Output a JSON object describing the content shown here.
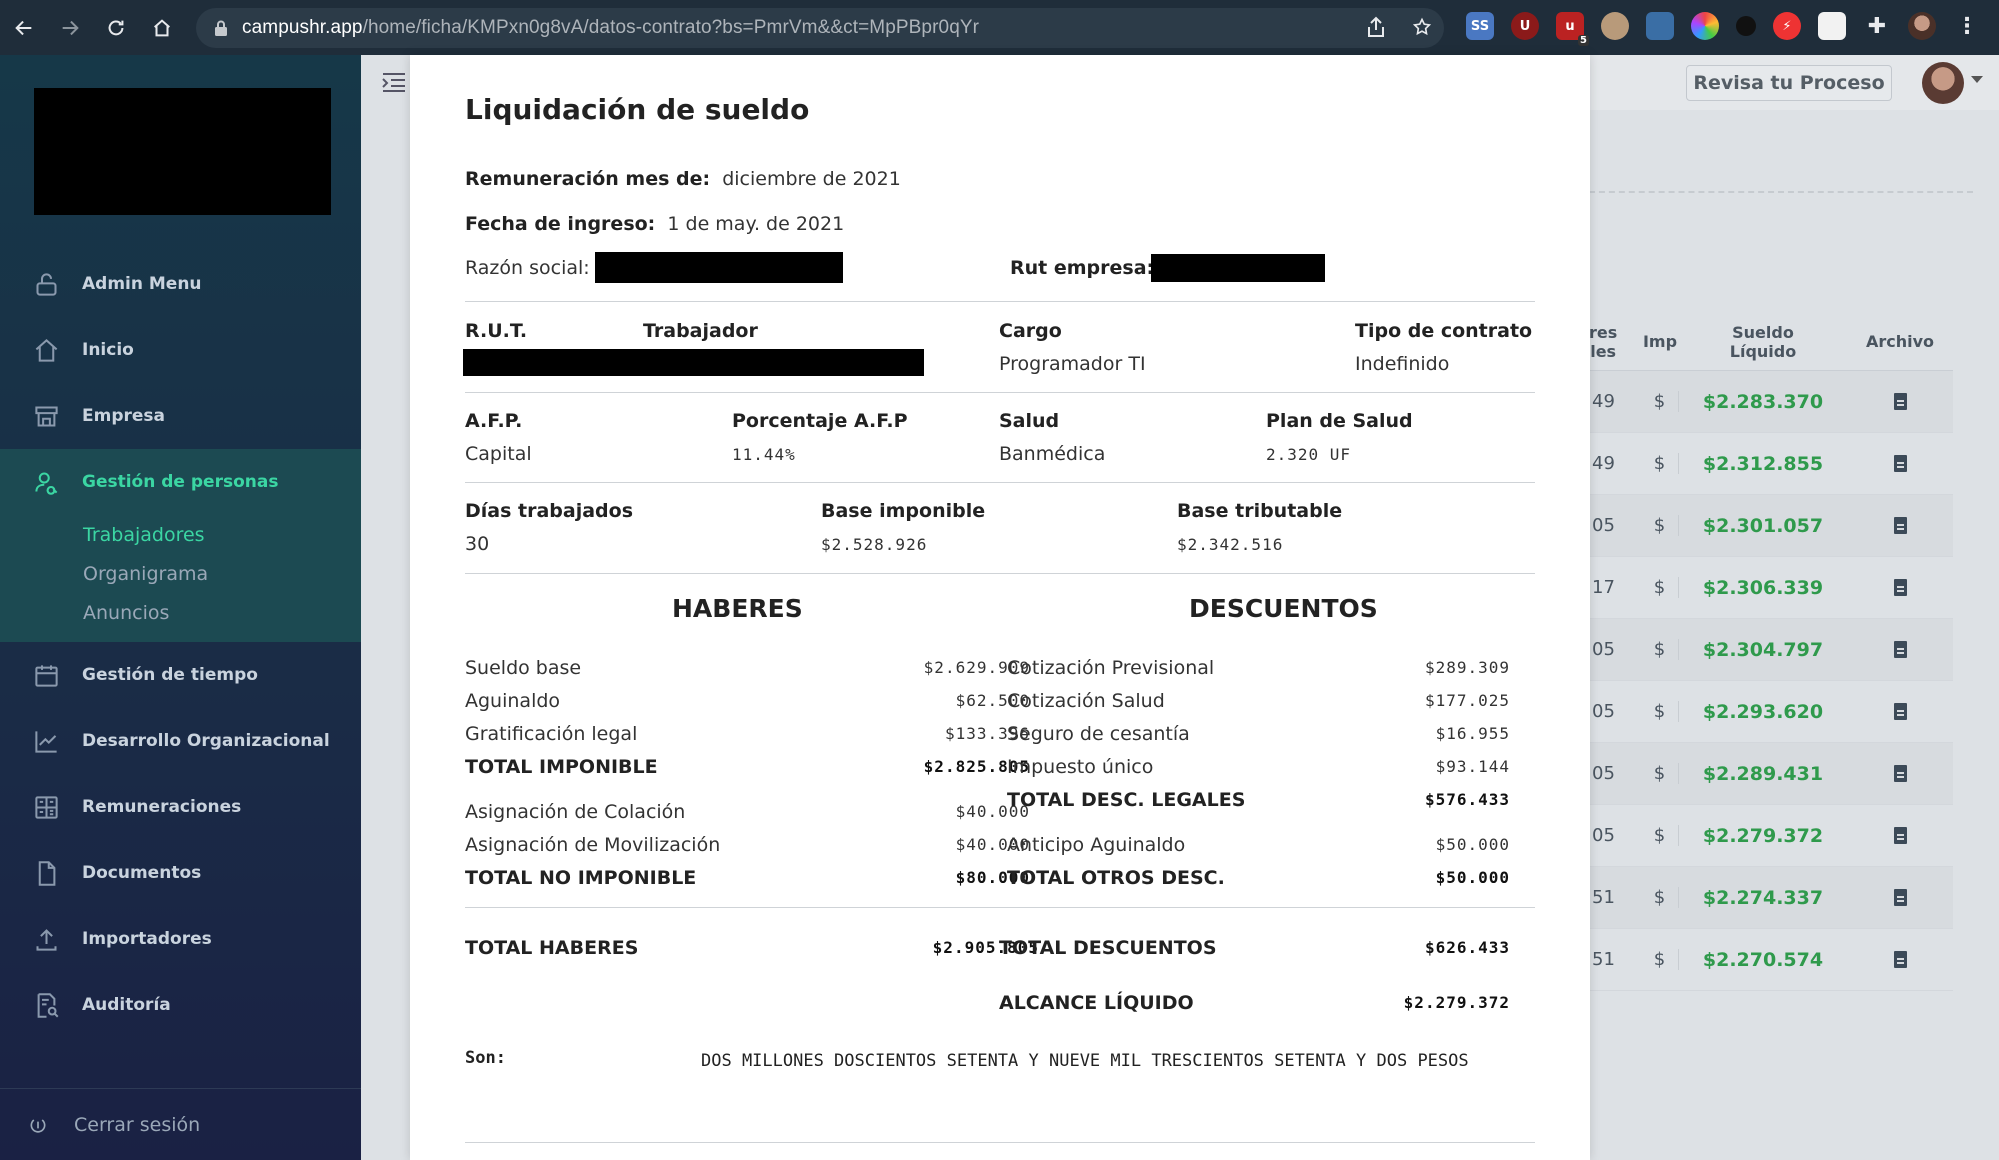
{
  "browser": {
    "url_host": "campushr.app",
    "url_path": "/home/ficha/KMPxn0g8vA/datos-contrato?bs=PmrVm&&ct=MpPBpr0qYr",
    "ext_badge": "5"
  },
  "sidebar": {
    "items": [
      {
        "label": "Admin Menu"
      },
      {
        "label": "Inicio"
      },
      {
        "label": "Empresa"
      },
      {
        "label": "Gestión de personas"
      },
      {
        "label": "Gestión de tiempo"
      },
      {
        "label": "Desarrollo Organizacional"
      },
      {
        "label": "Remuneraciones"
      },
      {
        "label": "Documentos"
      },
      {
        "label": "Importadores"
      },
      {
        "label": "Auditoría"
      }
    ],
    "subitems": [
      "Trabajadores",
      "Organigrama",
      "Anuncios"
    ],
    "logout": "Cerrar sesión"
  },
  "header": {
    "revisa_button": "Revisa tu Proceso"
  },
  "background_table": {
    "headers": [
      "res\nles",
      "Imp",
      "Sueldo\nLíquido",
      "Archivo"
    ],
    "rows": [
      {
        "c1": "49",
        "c2": "$",
        "liquido": "$2.283.370"
      },
      {
        "c1": "49",
        "c2": "$",
        "liquido": "$2.312.855"
      },
      {
        "c1": "05",
        "c2": "$",
        "liquido": "$2.301.057"
      },
      {
        "c1": "17",
        "c2": "$",
        "liquido": "$2.306.339"
      },
      {
        "c1": "05",
        "c2": "$",
        "liquido": "$2.304.797"
      },
      {
        "c1": "05",
        "c2": "$",
        "liquido": "$2.293.620"
      },
      {
        "c1": "05",
        "c2": "$",
        "liquido": "$2.289.431"
      },
      {
        "c1": "05",
        "c2": "$",
        "liquido": "$2.279.372"
      },
      {
        "c1": "51",
        "c2": "$",
        "liquido": "$2.274.337"
      },
      {
        "c1": "51",
        "c2": "$",
        "liquido": "$2.270.574"
      }
    ]
  },
  "liquidacion": {
    "title": "Liquidación de sueldo",
    "remuneracion_label": "Remuneración mes de:",
    "remuneracion_value": "diciembre de 2021",
    "ingreso_label": "Fecha de ingreso:",
    "ingreso_value": "1 de may. de 2021",
    "razon_label": "Razón social:",
    "rut_empresa_label": "Rut empresa:",
    "rut_label": "R.U.T.",
    "trabajador_label": "Trabajador",
    "cargo_label": "Cargo",
    "cargo_value": "Programador TI",
    "contrato_label": "Tipo de contrato",
    "contrato_value": "Indefinido",
    "afp_label": "A.F.P.",
    "afp_value": "Capital",
    "afp_pct_label": "Porcentaje A.F.P",
    "afp_pct_value": "11.44%",
    "salud_label": "Salud",
    "salud_value": "Banmédica",
    "plan_label": "Plan de Salud",
    "plan_value": "2.320 UF",
    "dias_label": "Días trabajados",
    "dias_value": "30",
    "base_imp_label": "Base imponible",
    "base_imp_value": "$2.528.926",
    "base_trib_label": "Base tributable",
    "base_trib_value": "$2.342.516",
    "haberes_title": "HABERES",
    "descuentos_title": "DESCUENTOS",
    "haberes": [
      {
        "label": "Sueldo base",
        "value": "$2.629.909"
      },
      {
        "label": "Aguinaldo",
        "value": "$62.500"
      },
      {
        "label": "Gratificación legal",
        "value": "$133.396"
      },
      {
        "label": "TOTAL IMPONIBLE",
        "value": "$2.825.805"
      },
      {
        "label": "Asignación de Colación",
        "value": "$40.000"
      },
      {
        "label": "Asignación de Movilización",
        "value": "$40.000"
      },
      {
        "label": "TOTAL NO IMPONIBLE",
        "value": "$80.000"
      }
    ],
    "descuentos": [
      {
        "label": "Cotización Previsional",
        "value": "$289.309"
      },
      {
        "label": "Cotización Salud",
        "value": "$177.025"
      },
      {
        "label": "Seguro de cesantía",
        "value": "$16.955"
      },
      {
        "label": "Impuesto único",
        "value": "$93.144"
      },
      {
        "label": "TOTAL DESC. LEGALES",
        "value": "$576.433"
      },
      {
        "label": "Anticipo Aguinaldo",
        "value": "$50.000"
      },
      {
        "label": "TOTAL OTROS DESC.",
        "value": "$50.000"
      }
    ],
    "total_haberes_label": "TOTAL HABERES",
    "total_haberes_value": "$2.905.805",
    "total_descuentos_label": "TOTAL DESCUENTOS",
    "total_descuentos_value": "$626.433",
    "alcance_label": "ALCANCE LÍQUIDO",
    "alcance_value": "$2.279.372",
    "son_label": "Son:",
    "son_text": "DOS MILLONES DOSCIENTOS SETENTA Y NUEVE MIL TRESCIENTOS SETENTA Y DOS PESOS"
  }
}
